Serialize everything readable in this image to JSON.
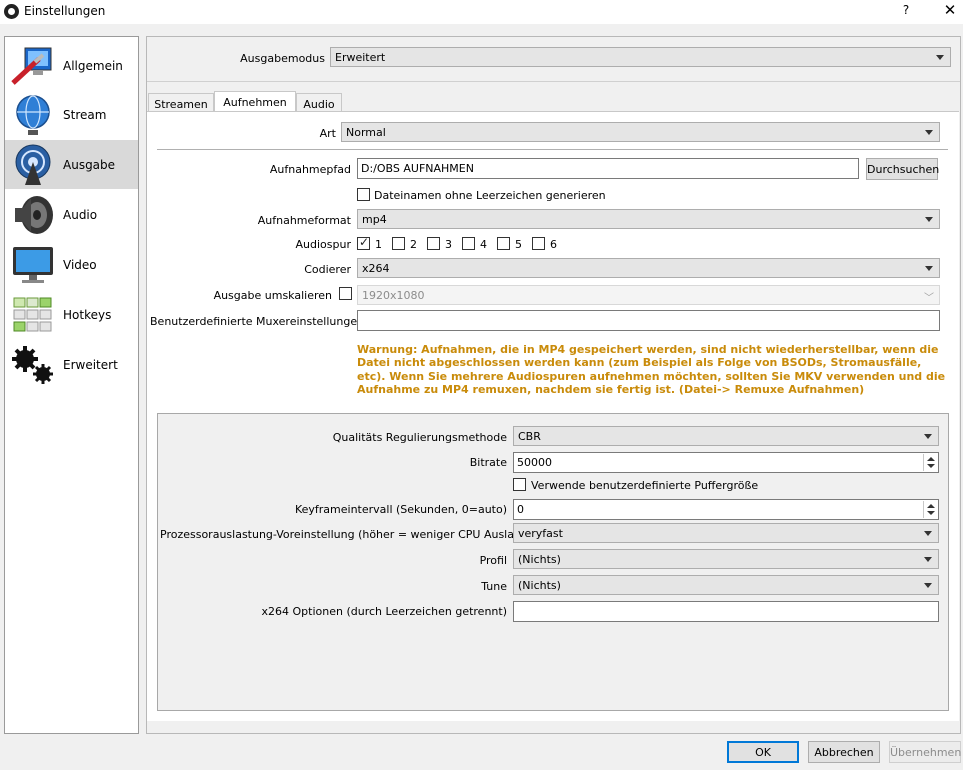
{
  "window": {
    "title": "Einstellungen",
    "help": "?",
    "close": "✕"
  },
  "sidebar": {
    "items": [
      {
        "label": "Allgemein"
      },
      {
        "label": "Stream"
      },
      {
        "label": "Ausgabe",
        "selected": true
      },
      {
        "label": "Audio"
      },
      {
        "label": "Video"
      },
      {
        "label": "Hotkeys"
      },
      {
        "label": "Erweitert"
      }
    ]
  },
  "output_mode": {
    "label": "Ausgabemodus",
    "value": "Erweitert"
  },
  "tabs": [
    {
      "label": "Streamen"
    },
    {
      "label": "Aufnehmen",
      "active": true
    },
    {
      "label": "Audio"
    }
  ],
  "recording": {
    "type_label": "Art",
    "type_value": "Normal",
    "path_label": "Aufnahmepfad",
    "path_value": "D:/OBS AUFNAHMEN",
    "browse_label": "Durchsuchen",
    "no_spaces_label": "Dateinamen ohne Leerzeichen generieren",
    "no_spaces_checked": false,
    "format_label": "Aufnahmeformat",
    "format_value": "mp4",
    "audio_track_label": "Audiospur",
    "audio_tracks": [
      {
        "label": "1",
        "checked": true
      },
      {
        "label": "2",
        "checked": false
      },
      {
        "label": "3",
        "checked": false
      },
      {
        "label": "4",
        "checked": false
      },
      {
        "label": "5",
        "checked": false
      },
      {
        "label": "6",
        "checked": false
      }
    ],
    "encoder_label": "Codierer",
    "encoder_value": "x264",
    "rescale_label": "Ausgabe umskalieren",
    "rescale_checked": false,
    "rescale_value": "1920x1080",
    "muxer_label": "Benutzerdefinierte Muxereinstellungen",
    "muxer_value": "",
    "warning": "Warnung: Aufnahmen, die in MP4 gespeichert werden, sind nicht wiederherstellbar, wenn die Datei nicht abgeschlossen werden kann (zum Beispiel als Folge von BSODs, Stromausfälle, etc). Wenn Sie mehrere Audiospuren aufnehmen möchten, sollten Sie MKV verwenden und die Aufnahme zu MP4 remuxen, nachdem sie fertig ist. (Datei-> Remuxe Aufnahmen)"
  },
  "encoder_settings": {
    "rate_control_label": "Qualitäts Regulierungsmethode",
    "rate_control_value": "CBR",
    "bitrate_label": "Bitrate",
    "bitrate_value": "50000",
    "custom_buffer_label": "Verwende benutzerdefinierte Puffergröße",
    "custom_buffer_checked": false,
    "keyframe_label": "Keyframeintervall (Sekunden, 0=auto)",
    "keyframe_value": "0",
    "preset_label": "Prozessorauslastung-Voreinstellung (höher = weniger CPU Auslastung)",
    "preset_value": "veryfast",
    "profile_label": "Profil",
    "profile_value": "(Nichts)",
    "tune_label": "Tune",
    "tune_value": "(Nichts)",
    "x264_opts_label": "x264 Optionen (durch Leerzeichen getrennt)",
    "x264_opts_value": ""
  },
  "footer": {
    "ok": "OK",
    "cancel": "Abbrechen",
    "apply": "Übernehmen"
  },
  "colors": {
    "warning": "#c98b0a",
    "selected": "#d9d9d9",
    "accent": "#0078d7"
  }
}
